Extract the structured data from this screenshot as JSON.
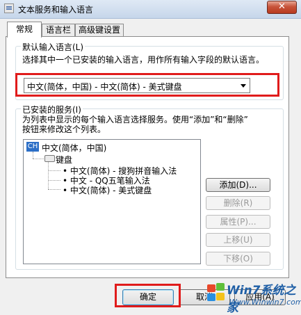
{
  "window": {
    "title": "文本服务和输入语言",
    "close_glyph": "✕"
  },
  "tabs": [
    {
      "label": "常规",
      "active": true
    },
    {
      "label": "语言栏",
      "active": false
    },
    {
      "label": "高级键设置",
      "active": false
    }
  ],
  "default_language": {
    "group_title": "默认输入语言(L)",
    "description": "选择其中一个已安装的输入语言，用作所有输入字段的默认语言。",
    "selected": "中文(简体，中国) - 中文(简体) - 美式键盘"
  },
  "installed_services": {
    "group_title": "已安装的服务(I)",
    "description_line1": "为列表中显示的每个输入语言选择服务。使用“添加”和“删除”",
    "description_line2": "按钮来修改这个列表。",
    "tree": {
      "language_badge": "CH",
      "language": "中文(简体，中国)",
      "keyboard_label": "键盘",
      "items": [
        "中文(简体) - 搜狗拼音输入法",
        "中文 - QQ五笔输入法",
        "中文(简体) - 美式键盘"
      ]
    },
    "buttons": {
      "add": "添加(D)...",
      "remove": "删除(R)",
      "properties": "属性(P)...",
      "move_up": "上移(U)",
      "move_down": "下移(O)"
    }
  },
  "footer": {
    "ok": "确定",
    "cancel": "取消",
    "apply": "应用(A)"
  },
  "watermark": {
    "title": "Win7系统之家",
    "url": "Www.Winwin7.com"
  },
  "colors": {
    "highlight": "#e01b1b",
    "accent": "#2c6fc7"
  }
}
